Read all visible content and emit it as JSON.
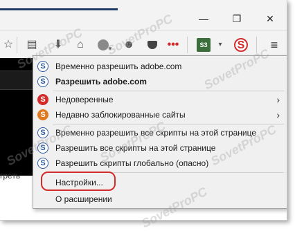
{
  "titlebar": {
    "minimize_glyph": "—",
    "restore_glyph": "❐",
    "close_glyph": "✕"
  },
  "toolbar": {
    "icons": [
      "star-icon",
      "clipboard-icon",
      "download-icon",
      "home-icon",
      "browser-icon",
      "smiley-icon",
      "pocket-icon",
      "dots-icon",
      "s3-icon",
      "noscript-icon",
      "menu-icon"
    ],
    "s3_label": "S3"
  },
  "content": {
    "side_text": "греть"
  },
  "menu": {
    "items": [
      {
        "label": "Временно разрешить adobe.com"
      },
      {
        "label": "Разрешить adobe.com"
      },
      {
        "label": "Недоверенные"
      },
      {
        "label": "Недавно заблокированные сайты"
      },
      {
        "label": "Временно разрешить все скрипты на этой странице"
      },
      {
        "label": "Разрешить все скрипты на этой странице"
      },
      {
        "label": "Разрешить скрипты глобально (опасно)"
      },
      {
        "label": "Настройки..."
      },
      {
        "label": "О расширении"
      }
    ],
    "submenu_arrow": "›",
    "icon_letter": "S"
  },
  "watermark": {
    "text": "SovetProPC"
  },
  "colors": {
    "accent_red": "#d32a2a",
    "dark_blue": "#1f3a64",
    "menu_bg": "#f0f0f0"
  }
}
